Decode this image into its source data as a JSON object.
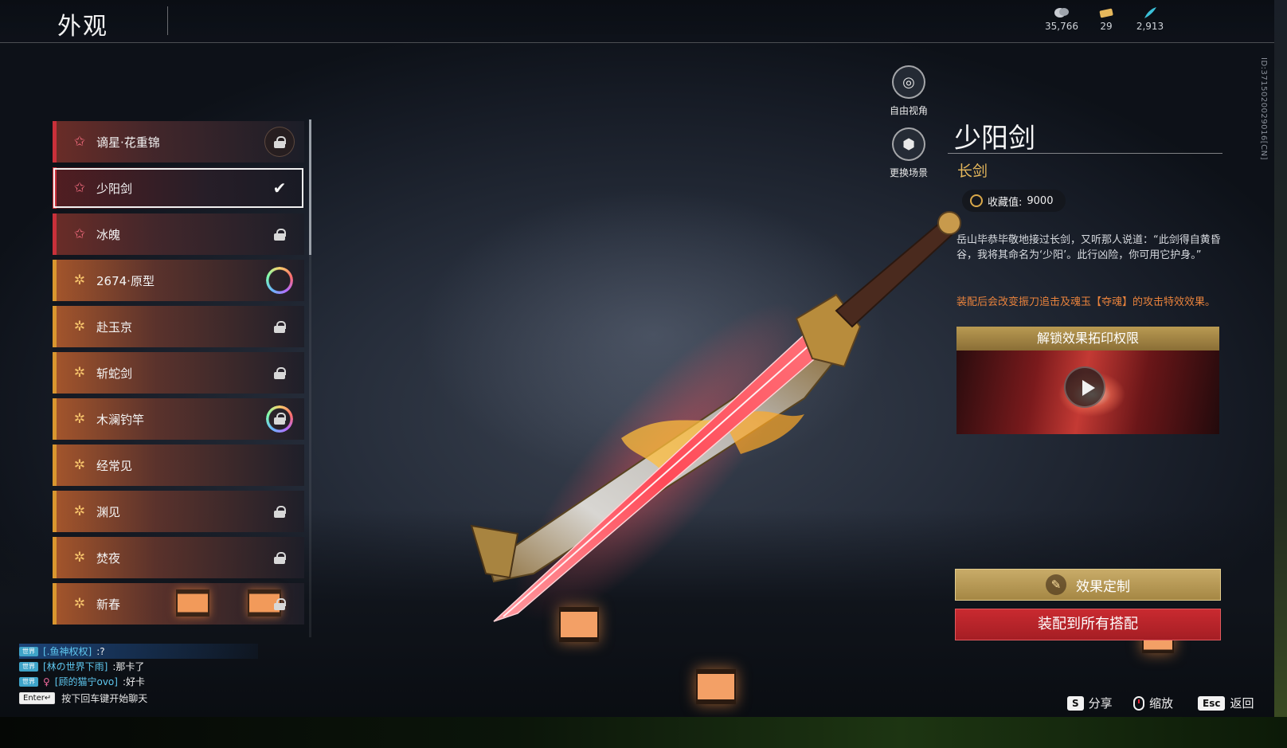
{
  "header": {
    "title": "外观",
    "currencies": [
      {
        "icon": "coin-stack-icon",
        "value": "35,766"
      },
      {
        "icon": "ticket-icon",
        "value": "29"
      },
      {
        "icon": "feather-icon",
        "value": "2,913"
      }
    ]
  },
  "side_id": "ID:3715020029016[CN]",
  "list": {
    "items": [
      {
        "name": "谪星·花重锦",
        "rarity": "red",
        "status": "lock-badge"
      },
      {
        "name": "少阳剑",
        "rarity": "red",
        "status": "check",
        "selected": true
      },
      {
        "name": "冰魄",
        "rarity": "red",
        "status": "lock"
      },
      {
        "name": "2674·原型",
        "rarity": "gold",
        "status": "ring"
      },
      {
        "name": "赴玉京",
        "rarity": "gold",
        "status": "lock"
      },
      {
        "name": "斩蛇剑",
        "rarity": "gold",
        "status": "lock"
      },
      {
        "name": "木澜钓竿",
        "rarity": "gold",
        "status": "ring-lock"
      },
      {
        "name": "经常见",
        "rarity": "gold",
        "status": "none"
      },
      {
        "name": "渊见",
        "rarity": "gold",
        "status": "lock"
      },
      {
        "name": "焚夜",
        "rarity": "gold",
        "status": "lock"
      },
      {
        "name": "新春",
        "rarity": "gold",
        "status": "lock"
      }
    ]
  },
  "camera": {
    "free_view": "自由视角",
    "change_scene": "更换场景"
  },
  "detail": {
    "name": "少阳剑",
    "type": "长剑",
    "collect_label": "收藏值:",
    "collect_value": "9000",
    "description": "岳山毕恭毕敬地接过长剑，又听那人说道：“此剑得自黄昏谷，我将其命名为‘少阳’。此行凶险，你可用它护身。”",
    "effect_note": "装配后会改变振刀追击及魂玉【夺魂】的攻击特效效果。",
    "preview_title": "解锁效果拓印权限",
    "custom_button": "效果定制",
    "equip_button": "装配到所有搭配"
  },
  "hints": [
    {
      "key": "S",
      "label": "分享"
    },
    {
      "key": "mouse",
      "label": "缩放"
    },
    {
      "key": "Esc",
      "label": "返回"
    }
  ],
  "chat": {
    "messages": [
      {
        "channel": "世界",
        "name": "[.鱼神权权]",
        "text": ":?"
      },
      {
        "channel": "世界",
        "name": "[林の世界下雨]",
        "text": ":那卡了"
      },
      {
        "channel": "世界",
        "name": "[顾的猫宁ovo]",
        "text": ":好卡"
      }
    ],
    "enter_key": "Enter↵",
    "enter_hint": "按下回车键开始聊天"
  },
  "colors": {
    "accent_gold": "#e6b85c",
    "equip_red": "#c92a30",
    "rarity_red": "#c9303a",
    "rarity_gold": "#d9962f"
  }
}
